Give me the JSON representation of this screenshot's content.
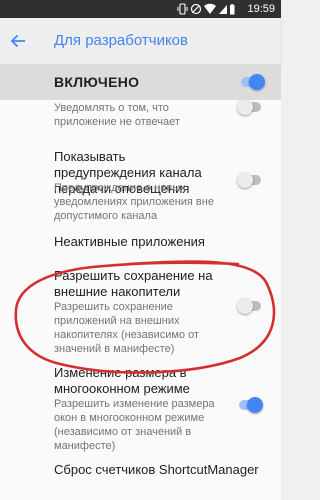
{
  "statusbar": {
    "time": "19:59"
  },
  "appbar": {
    "title": "Для разработчиков"
  },
  "master": {
    "label": "ВКЛЮЧЕНО",
    "enabled": true
  },
  "settings": [
    {
      "title": "",
      "summary": "Уведомлять о том, что приложение не отвечает",
      "toggle": "off"
    },
    {
      "title": "Показывать предупреждения канала передачи оповещения",
      "summary": "Предупреждение о новых уведомлениях приложения вне допустимого канала",
      "toggle": "off"
    },
    {
      "title": "Неактивные приложения",
      "summary": "",
      "toggle": "none"
    },
    {
      "title": "Разрешить сохранение на внешние накопители",
      "summary": "Разрешить сохранение приложений на внешних накопителях (независимо от значений в манифесте)",
      "toggle": "off"
    },
    {
      "title": "Изменение размера в многооконном режиме",
      "summary": "Разрешить изменение размера окон в многооконном режиме (независимо от значений в манифесте)",
      "toggle": "on"
    },
    {
      "title": "Сброс счетчиков ShortcutManager",
      "summary": "",
      "toggle": "none"
    }
  ],
  "colors": {
    "accent": "#4285f4",
    "annotation": "#d32f2f",
    "statusbar": "#303030"
  }
}
